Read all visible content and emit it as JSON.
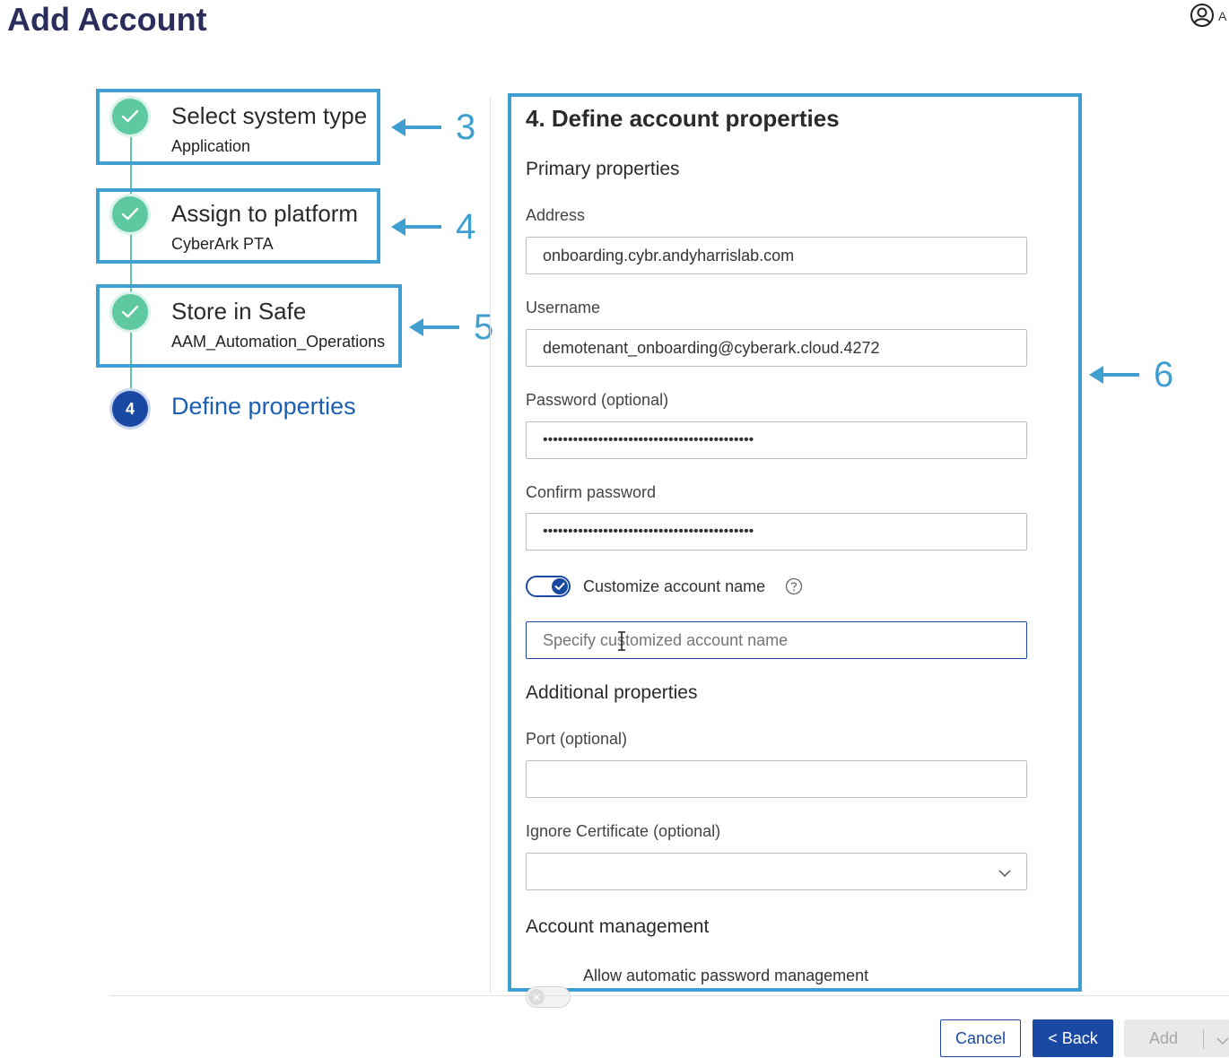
{
  "header": {
    "title": "Add Account",
    "user_initial": "A"
  },
  "steps": [
    {
      "title": "Select system type",
      "value": "Application",
      "annotation": "3"
    },
    {
      "title": "Assign to platform",
      "value": "CyberArk PTA",
      "annotation": "4"
    },
    {
      "title": "Store in Safe",
      "value": "AAM_Automation_Operations",
      "annotation": "5"
    },
    {
      "number": "4",
      "title": "Define properties"
    }
  ],
  "form": {
    "annotation": "6",
    "title": "4. Define account properties",
    "primary_section": "Primary properties",
    "address": {
      "label": "Address",
      "value": "onboarding.cybr.andyharrislab.com"
    },
    "username": {
      "label": "Username",
      "value": "demotenant_onboarding@cyberark.cloud.4272"
    },
    "password": {
      "label": "Password (optional)",
      "value": "••••••••••••••••••••••••••••••••••••••••••"
    },
    "confirm_password": {
      "label": "Confirm password",
      "value": "••••••••••••••••••••••••••••••••••••••••••"
    },
    "customize_toggle": {
      "label": "Customize account name",
      "on": true
    },
    "custom_name": {
      "placeholder": "Specify customized account name"
    },
    "additional_section": "Additional properties",
    "port": {
      "label": "Port (optional)",
      "value": ""
    },
    "ignore_cert": {
      "label": "Ignore Certificate (optional)",
      "value": ""
    },
    "management_section": "Account management",
    "auto_pw_toggle": {
      "label": "Allow automatic password management",
      "on": false
    }
  },
  "footer": {
    "cancel": "Cancel",
    "back": "< Back",
    "add": "Add"
  },
  "colors": {
    "accent": "#1a49a3",
    "success": "#5ec8a0",
    "annotation": "#3f9fd0",
    "title": "#2b2d5c"
  }
}
